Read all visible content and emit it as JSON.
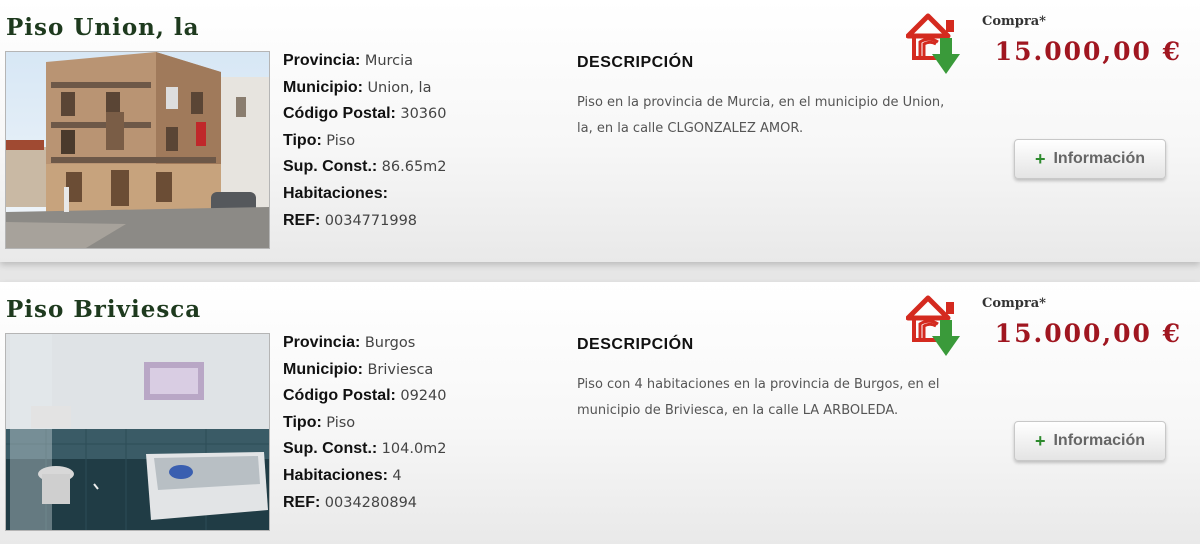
{
  "listings": [
    {
      "title": "Piso Union, la",
      "photo_icon": "building-photo",
      "specs": [
        {
          "key": "Provincia:",
          "value": "Murcia"
        },
        {
          "key": "Municipio:",
          "value": "Union, la"
        },
        {
          "key": "Código Postal:",
          "value": "30360"
        },
        {
          "key": "Tipo:",
          "value": "Piso"
        },
        {
          "key": "Sup. Const.:",
          "value": "86.65m2"
        },
        {
          "key": "Habitaciones:",
          "value": ""
        },
        {
          "key": "REF:",
          "value": "0034771998"
        }
      ],
      "description_heading": "DESCRIPCIÓN",
      "description": "Piso en la provincia de Murcia, en el municipio de Union, la, en la calle CLGONZALEZ AMOR.",
      "purchase_label": "Compra*",
      "price": "15.000,00 €",
      "button": {
        "plus": "+",
        "label": "Información"
      }
    },
    {
      "title": "Piso Briviesca",
      "photo_icon": "bathroom-photo",
      "specs": [
        {
          "key": "Provincia:",
          "value": "Burgos"
        },
        {
          "key": "Municipio:",
          "value": "Briviesca"
        },
        {
          "key": "Código Postal:",
          "value": "09240"
        },
        {
          "key": "Tipo:",
          "value": "Piso"
        },
        {
          "key": "Sup. Const.:",
          "value": "104.0m2"
        },
        {
          "key": "Habitaciones:",
          "value": "4"
        },
        {
          "key": "REF:",
          "value": "0034280894"
        }
      ],
      "description_heading": "DESCRIPCIÓN",
      "description": "Piso con 4 habitaciones en la provincia de Burgos, en el municipio de Briviesca, en la calle LA ARBOLEDA.",
      "purchase_label": "Compra*",
      "price": "15.000,00 €",
      "button": {
        "plus": "+",
        "label": "Información"
      }
    }
  ],
  "colors": {
    "title": "#1e3a1e",
    "price": "#a01620",
    "logo_red": "#d42a1f",
    "logo_green": "#3a9a3a",
    "button_plus": "#2d8a2d"
  },
  "icons": {
    "logo": "house-arrow-logo-icon",
    "info": "plus-icon"
  }
}
